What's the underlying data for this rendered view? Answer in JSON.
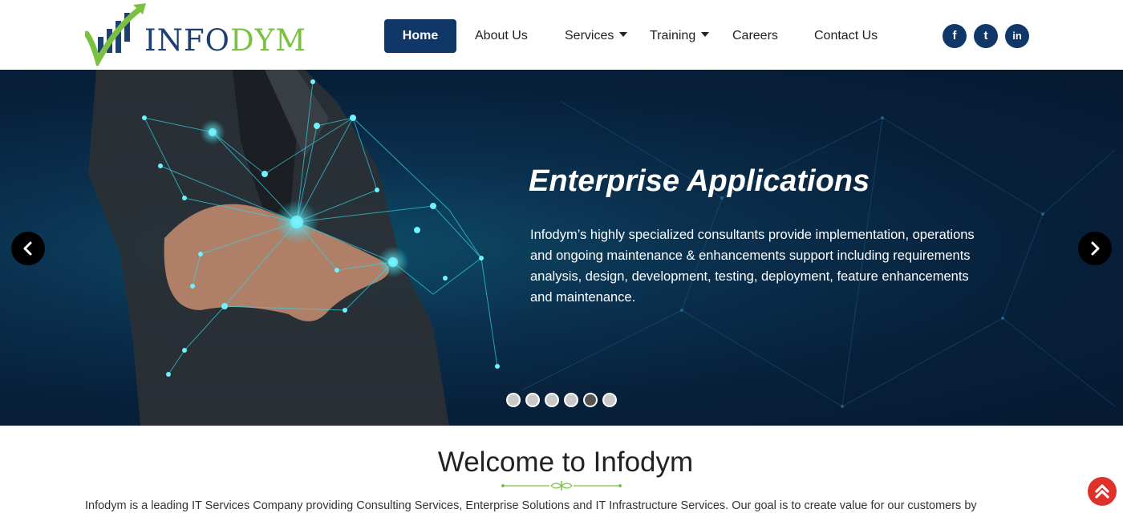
{
  "logo": {
    "part1": "INFO",
    "part2": "DYM"
  },
  "nav": {
    "home": "Home",
    "about": "About Us",
    "services": "Services",
    "training": "Training",
    "careers": "Careers",
    "contact": "Contact Us"
  },
  "social": {
    "facebook": "f",
    "twitter": "t",
    "linkedin": "in"
  },
  "hero": {
    "title": "Enterprise Applications",
    "text": "Infodym’s highly specialized consultants provide implementation, operations and ongoing maintenance & enhancements support including requirements analysis, design, development, testing, deployment, feature enhancements and maintenance.",
    "slide_count": 6,
    "active_slide": 5
  },
  "welcome": {
    "title": "Welcome to Infodym",
    "intro": "Infodym is a leading IT Services Company providing Consulting Services, Enterprise Solutions and IT Infrastructure Services. Our goal is to create value for our customers by"
  },
  "colors": {
    "brand_blue": "#0f3767",
    "brand_green": "#7bc043",
    "scroll_top": "#e0302a"
  },
  "icons": {
    "prev": "chevron-left-icon",
    "next": "chevron-right-icon",
    "scroll_top": "double-chevron-up-icon"
  }
}
